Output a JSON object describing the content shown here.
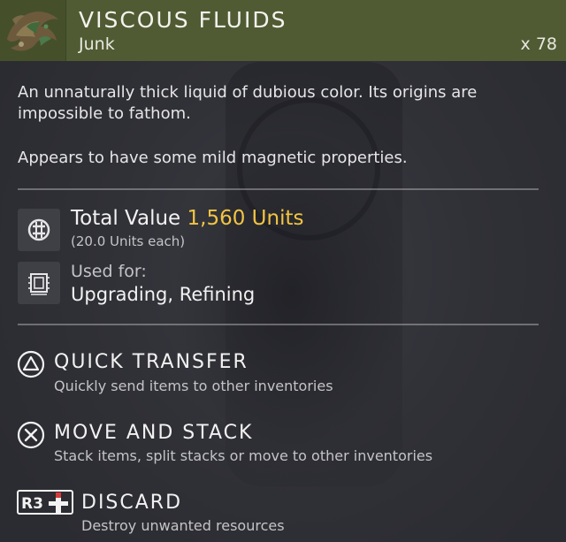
{
  "item": {
    "name": "VISCOUS FLUIDS",
    "category": "Junk",
    "quantity": "x 78",
    "header_color": "#515b33",
    "icon": "viscous-fluids-icon"
  },
  "description": {
    "line1": "An unnaturally thick liquid of dubious color. Its origins are impossible to fathom.",
    "line2": "Appears to have some mild magnetic properties."
  },
  "value": {
    "label": "Total Value",
    "amount": "1,560 Units",
    "each": "(20.0 Units each)",
    "icon": "units-icon",
    "amount_color": "#f2c443"
  },
  "usage": {
    "label": "Used for:",
    "value": "Upgrading, Refining",
    "icon": "chip-icon"
  },
  "actions": [
    {
      "icon": "triangle-button-icon",
      "title": "QUICK TRANSFER",
      "desc": "Quickly send items to other inventories"
    },
    {
      "icon": "cross-button-icon",
      "title": "MOVE AND STACK",
      "desc": "Stack items, split stacks or move to other inventories"
    },
    {
      "icon": "r3-button-icon",
      "title": "DISCARD",
      "desc": "Destroy unwanted resources"
    }
  ]
}
